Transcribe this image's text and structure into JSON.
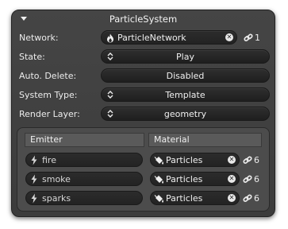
{
  "panel": {
    "title": "ParticleSystem"
  },
  "fields": {
    "network": {
      "label": "Network:",
      "value": "ParticleNetwork",
      "link_count": "1"
    },
    "state": {
      "label": "State:",
      "value": "Play"
    },
    "auto_delete": {
      "label": "Auto. Delete:",
      "value": "Disabled"
    },
    "system_type": {
      "label": "System Type:",
      "value": "Template"
    },
    "render_layer": {
      "label": "Render Layer:",
      "value": "geometry"
    }
  },
  "table": {
    "headers": {
      "emitter": "Emitter",
      "material": "Material"
    },
    "rows": [
      {
        "emitter": "fire",
        "material": "Particles",
        "link_count": "6"
      },
      {
        "emitter": "smoke",
        "material": "Particles",
        "link_count": "6"
      },
      {
        "emitter": "sparks",
        "material": "Particles",
        "link_count": "6"
      }
    ]
  },
  "icons": {
    "collapse": "collapse-triangle-icon",
    "network": "flame-icon",
    "clear": "clear-x-icon",
    "link": "link-chain-icon",
    "updown": "up-down-arrows-icon",
    "emitter": "lightning-bolt-icon",
    "material": "paint-bucket-icon"
  },
  "colors": {
    "panel_bg": "#404040",
    "field_bg": "#262626",
    "text": "#ececec",
    "inner_bg": "#4c4c4c"
  }
}
